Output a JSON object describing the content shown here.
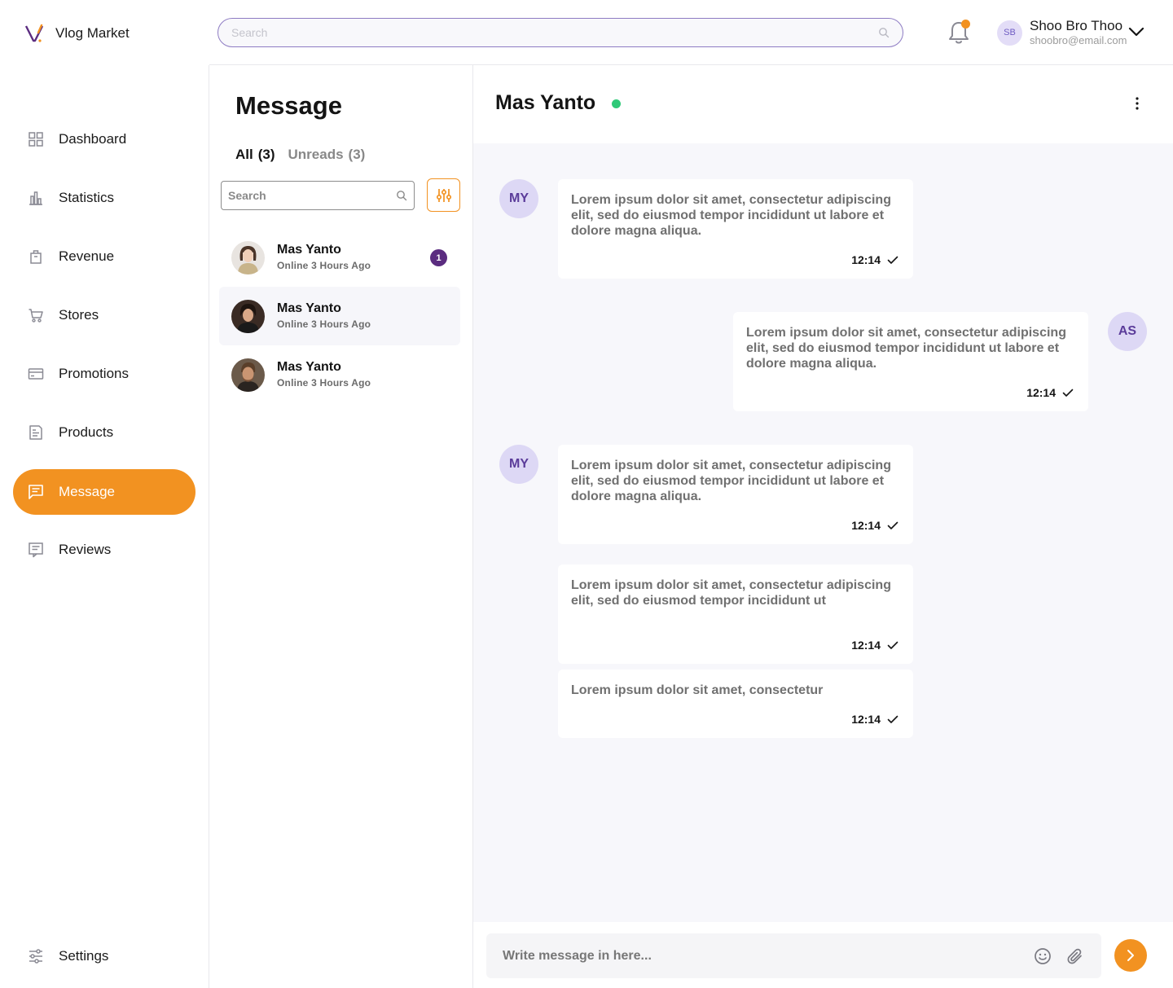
{
  "app": {
    "name": "Vlog Market"
  },
  "header": {
    "search_placeholder": "Search",
    "user": {
      "initials": "SB",
      "name": "Shoo Bro Thoo",
      "email": "shoobro@email.com"
    }
  },
  "sidebar": {
    "items": [
      {
        "label": "Dashboard",
        "icon": "grid-icon"
      },
      {
        "label": "Statistics",
        "icon": "bar-chart-icon"
      },
      {
        "label": "Revenue",
        "icon": "shopping-bag-icon"
      },
      {
        "label": "Stores",
        "icon": "cart-icon"
      },
      {
        "label": "Promotions",
        "icon": "card-icon"
      },
      {
        "label": "Products",
        "icon": "document-icon"
      },
      {
        "label": "Message",
        "icon": "message-icon",
        "active": true
      },
      {
        "label": "Reviews",
        "icon": "review-icon"
      }
    ],
    "settings_label": "Settings"
  },
  "message_list": {
    "title": "Message",
    "tabs": [
      {
        "label": "All",
        "count": "(3)"
      },
      {
        "label": "Unreads",
        "count": "(3)"
      }
    ],
    "search_placeholder": "Search",
    "contacts": [
      {
        "name": "Mas Yanto",
        "status": "Online 3 Hours Ago",
        "unread": "1"
      },
      {
        "name": "Mas Yanto",
        "status": "Online 3 Hours Ago"
      },
      {
        "name": "Mas Yanto",
        "status": "Online 3 Hours Ago"
      }
    ]
  },
  "chat": {
    "contact_name": "Mas Yanto",
    "messages": [
      {
        "avatar": "MY",
        "text": "Lorem ipsum dolor sit amet, consectetur adipiscing elit, sed do eiusmod tempor incididunt ut labore et dolore magna aliqua.",
        "time": "12:14"
      },
      {
        "avatar": "AS",
        "text": "Lorem ipsum dolor sit amet, consectetur adipiscing elit, sed do eiusmod tempor incididunt ut labore et dolore magna aliqua.",
        "time": "12:14"
      },
      {
        "avatar": "MY",
        "text": "Lorem ipsum dolor sit amet, consectetur adipiscing elit, sed do eiusmod tempor incididunt ut labore et dolore magna aliqua.",
        "time": "12:14"
      },
      {
        "text": "Lorem ipsum dolor sit amet, consectetur adipiscing elit, sed do eiusmod tempor incididunt ut",
        "time": "12:14"
      },
      {
        "text": "Lorem ipsum dolor sit amet, consectetur",
        "time": "12:14"
      }
    ],
    "composer_placeholder": "Write message in here..."
  },
  "colors": {
    "accent": "#f29221",
    "brand_purple": "#5b2c80",
    "online": "#2fc978",
    "chat_background": "#f7f7fb"
  }
}
